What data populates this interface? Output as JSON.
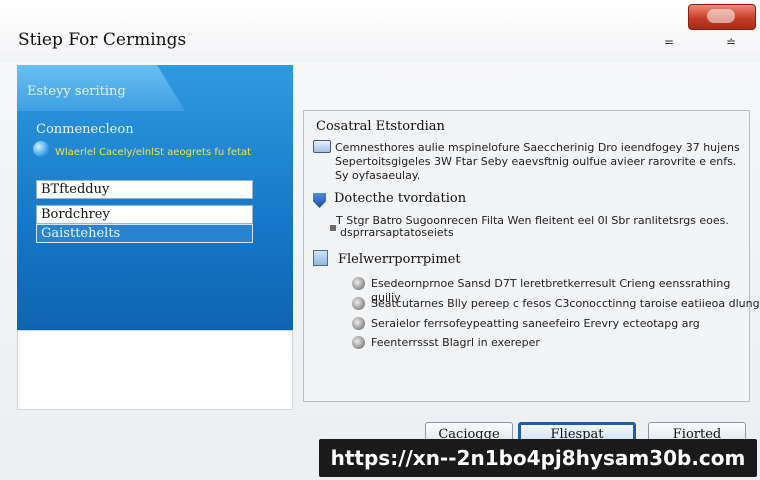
{
  "window": {
    "title": "Stiep For Cermings",
    "min_glyph": "=",
    "restore_glyph": "≐"
  },
  "left": {
    "tab_label": "Esteyy seriting",
    "section_label": "Conmenecleon",
    "hint": "Wlaerlel Cacely/elnlSt aeogrets fu fetat",
    "fields": [
      "BTftedduy",
      "Bordchrey",
      "Gaisttehelts"
    ]
  },
  "right": {
    "section1": {
      "heading": "Cosatral Etstordian",
      "lines": [
        "Cemnesthores aulie mspinelofure Saeccherinig Dro ieendfogey 37 hujens",
        "Sepertoitsgigeles 3W Ftar Seby eaevsftnig oulfue avieer rarovrite e enfs.",
        "Sy oyfasaeulay."
      ]
    },
    "section2": {
      "heading": "Dotecthe tvordation",
      "lines": [
        "T Stgr Batro Sugoonrecen Filta Wen fleitent eel 0I Sbr ranlitetsrgs eoes.",
        "dsprrarsaptatoseiets"
      ]
    },
    "section3": {
      "heading": "Flelwerrporrpimet",
      "bullets": [
        "Esedeornprnoe Sansd D7T leretbretkerresult Crieng eenssrathing quiliy",
        "Seatcutarnes Blly pereep c fesos C3conocctinng taroise eatiieoa dlung",
        "Seraielor ferrsofeypeatting saneefeiro Erevry ecteotapg arg",
        "Feenterrssst Blagrl in exereper"
      ]
    }
  },
  "buttons": {
    "back": "Caciogge",
    "next": "Fliespat",
    "cancel": "Fiorted"
  },
  "banner": {
    "url": "https://xn--2n1bo4pj8hysam30b.com"
  }
}
